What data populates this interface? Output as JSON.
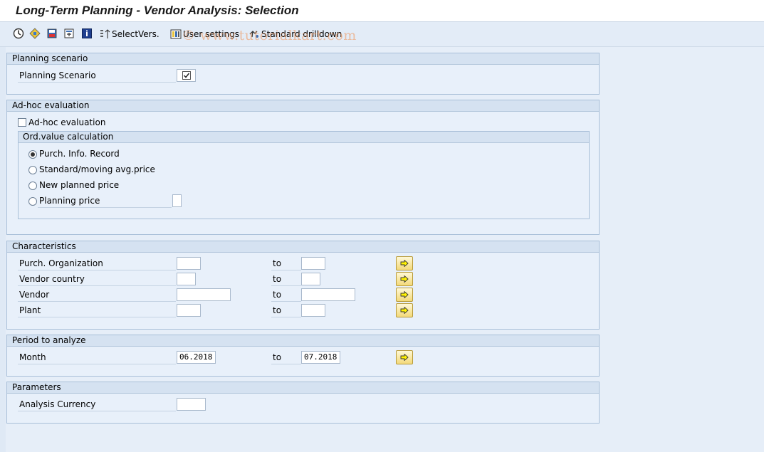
{
  "window": {
    "title": "Long-Term Planning - Vendor Analysis: Selection"
  },
  "toolbar": {
    "icons": [
      "execute-icon",
      "variant-icon",
      "save-variant-icon",
      "get-variant-icon",
      "info-icon"
    ],
    "select_vers_label": "SelectVers.",
    "user_settings_label": "User settings",
    "standard_drilldown_label": "Standard drilldown"
  },
  "watermark": "© www.tutorialkart.com",
  "planning_scenario": {
    "title": "Planning scenario",
    "field_label": "Planning Scenario",
    "checked": true
  },
  "adhoc": {
    "title": "Ad-hoc evaluation",
    "checkbox_label": "Ad-hoc evaluation",
    "checked": false,
    "ordvalue": {
      "title": "Ord.value calculation",
      "options": [
        {
          "label": "Purch. Info. Record",
          "selected": true
        },
        {
          "label": "Standard/moving avg.price",
          "selected": false
        },
        {
          "label": "New planned price",
          "selected": false
        },
        {
          "label": "Planning price",
          "selected": false
        }
      ]
    }
  },
  "characteristics": {
    "title": "Characteristics",
    "to_label": "to",
    "rows": [
      {
        "label": "Purch. Organization",
        "from": "",
        "to": ""
      },
      {
        "label": "Vendor country",
        "from": "",
        "to": ""
      },
      {
        "label": "Vendor",
        "from": "",
        "to": ""
      },
      {
        "label": "Plant",
        "from": "",
        "to": ""
      }
    ]
  },
  "period": {
    "title": "Period to analyze",
    "label": "Month",
    "from": "06.2018",
    "to_label": "to",
    "to": "07.2018"
  },
  "parameters": {
    "title": "Parameters",
    "label": "Analysis Currency",
    "value": ""
  },
  "colors": {
    "background": "#dfe9f5",
    "group_header": "#d5e2f1",
    "multi_select_button": "#f3d97a"
  }
}
